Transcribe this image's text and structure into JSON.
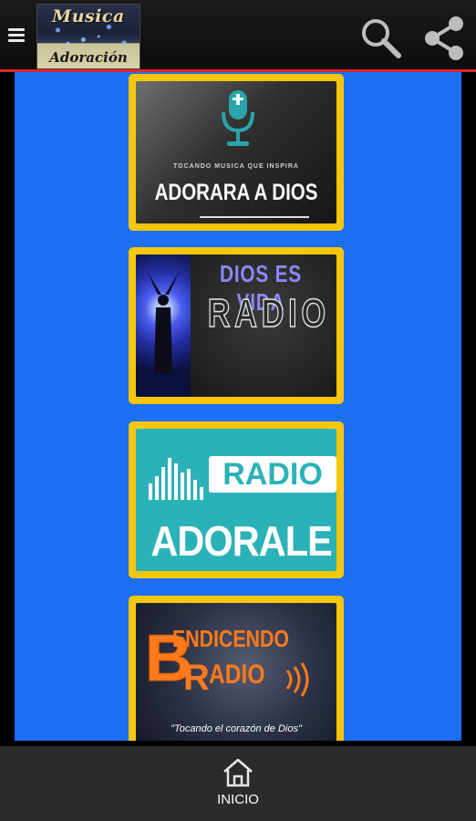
{
  "appbar": {
    "logo_line1": "Musica",
    "logo_line2": "Adoración",
    "menu_icon": "menu-icon",
    "search_icon": "search-icon",
    "share_icon": "share-icon"
  },
  "stations": [
    {
      "subtitle": "TOCANDO MUSICA QUE INSPIRA",
      "title": "ADORARA A DIOS"
    },
    {
      "title_line1": "DIOS ES VIDA",
      "title_line2": "RADIO"
    },
    {
      "title_line1": "RADIO",
      "title_line2": "ADORALE"
    },
    {
      "title_line1": "ENDICENDO",
      "title_initial": "B",
      "title_line2": "ADIO",
      "title_initial2": "R",
      "tagline": "\"Tocando el corazón de Dios\""
    }
  ],
  "bottomnav": {
    "home_label": "INICIO",
    "home_icon": "home-icon"
  },
  "colors": {
    "accent": "#e0252a",
    "content_bg": "#1c6ff2",
    "card_border": "#f6c60a",
    "adorale_bg": "#2bb2b8"
  }
}
